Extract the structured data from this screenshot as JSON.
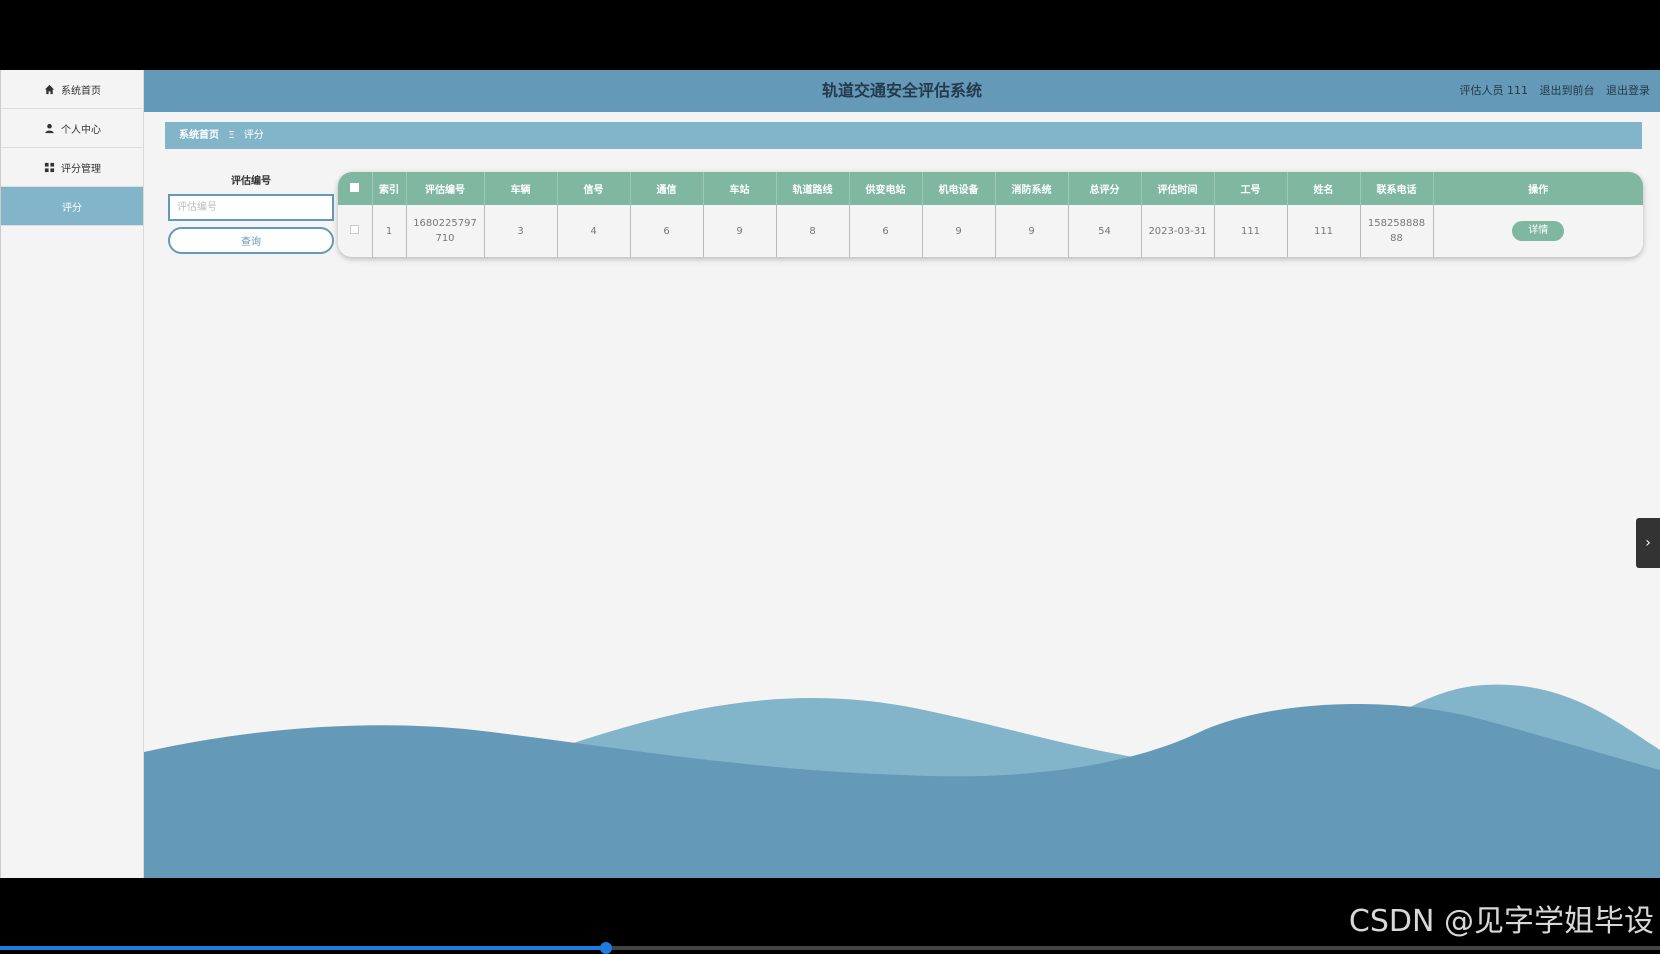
{
  "header": {
    "title": "轨道交通安全评估系统",
    "user_label": "评估人员 111",
    "front_link": "退出到前台",
    "logout_link": "退出登录"
  },
  "sidebar": {
    "items": [
      {
        "label": "系统首页",
        "icon": "home-icon"
      },
      {
        "label": "个人中心",
        "icon": "user-icon"
      },
      {
        "label": "评分管理",
        "icon": "grid-icon"
      },
      {
        "label": "评分",
        "icon": ""
      }
    ]
  },
  "breadcrumb": {
    "home": "系统首页",
    "separator": "Ξ",
    "current": "评分"
  },
  "search": {
    "label": "评估编号",
    "placeholder": "评估编号",
    "button": "查询"
  },
  "table": {
    "columns": [
      "索引",
      "评估编号",
      "车辆",
      "信号",
      "通信",
      "车站",
      "轨道路线",
      "供变电站",
      "机电设备",
      "消防系统",
      "总评分",
      "评估时间",
      "工号",
      "姓名",
      "联系电话",
      "操作"
    ],
    "rows": [
      {
        "cells": [
          "1",
          "1680225797710",
          "3",
          "4",
          "6",
          "9",
          "8",
          "6",
          "9",
          "9",
          "54",
          "2023-03-31",
          "111",
          "111",
          "15825888888"
        ],
        "action": "详情"
      }
    ]
  },
  "watermark": "CSDN @见字学姐毕设",
  "video_progress": 0.365,
  "colors": {
    "header": "#6599b8",
    "accent": "#83b5ca",
    "table_header": "#7fb7a1",
    "wave_dark": "#6599b8",
    "wave_light": "#83b5ca"
  }
}
